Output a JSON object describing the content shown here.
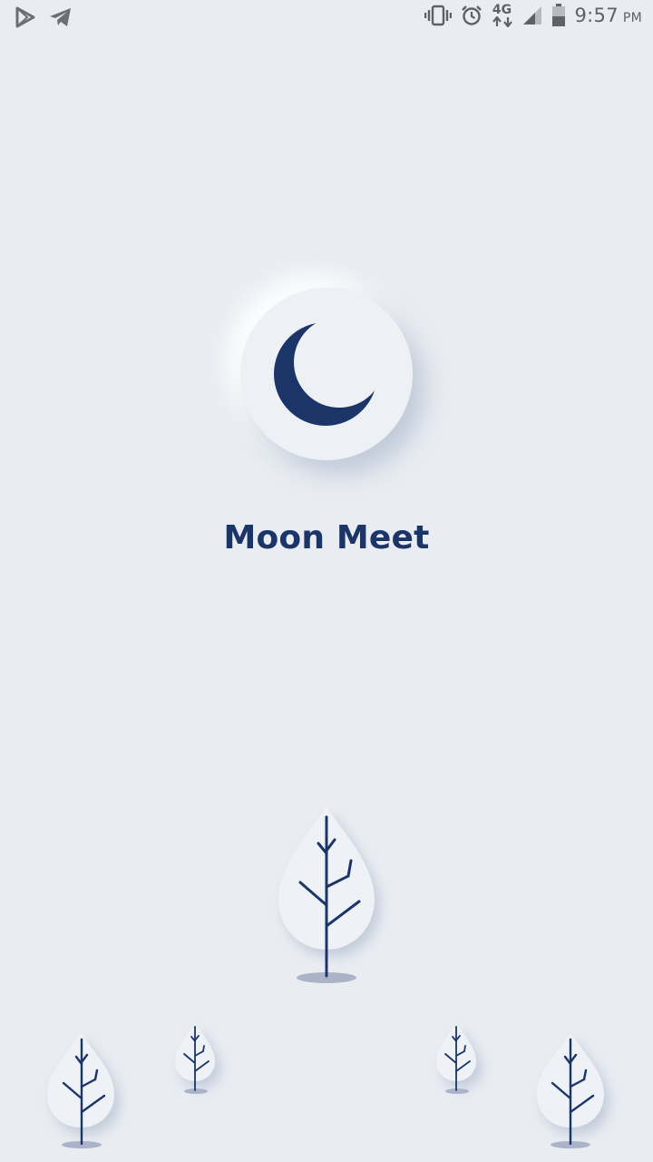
{
  "status_bar": {
    "time": "9:57",
    "ampm": "PM",
    "network": "4G",
    "icons": [
      "play-store-icon",
      "telegram-icon",
      "vibrate-icon",
      "alarm-icon",
      "network-4g-icon",
      "signal-icon",
      "battery-icon"
    ]
  },
  "app": {
    "title": "Moon Meet",
    "logo_icon": "crescent-moon-icon"
  },
  "colors": {
    "background": "#e9edf2",
    "brand": "#1b3568",
    "shadow": "#a3afc6"
  },
  "decorations": {
    "trees": [
      "tree-icon",
      "tree-icon",
      "tree-icon",
      "tree-icon",
      "tree-icon"
    ]
  }
}
